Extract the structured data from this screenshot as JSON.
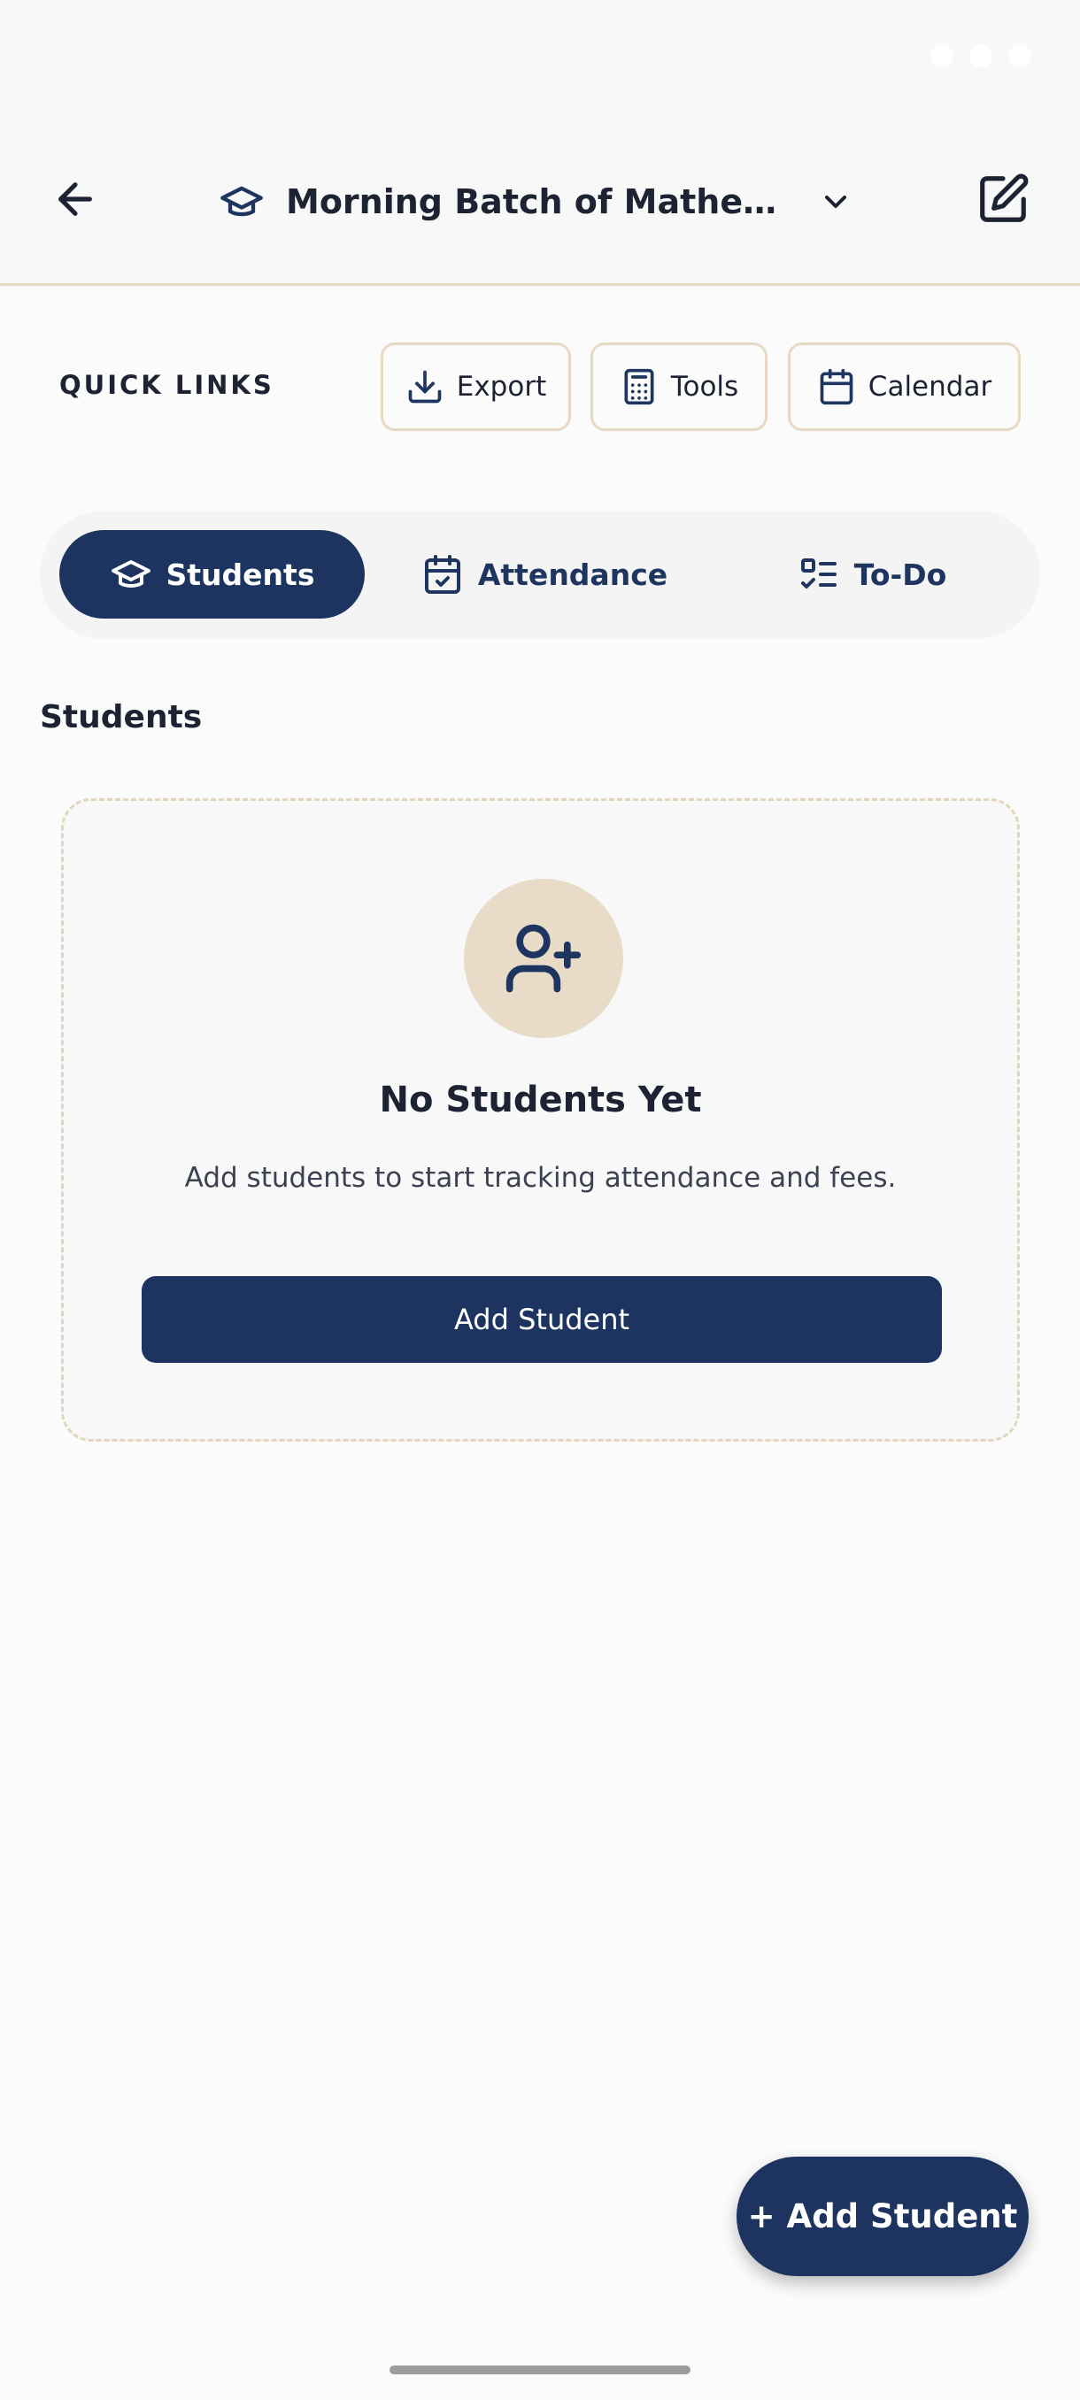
{
  "header": {
    "title": "Morning Batch of Mathemati...",
    "icon": "graduation-cap-icon"
  },
  "quick_links": {
    "label": "QUICK LINKS",
    "items": [
      {
        "label": "Export",
        "icon": "download-icon"
      },
      {
        "label": "Tools",
        "icon": "calculator-icon"
      },
      {
        "label": "Calendar",
        "icon": "calendar-icon"
      }
    ]
  },
  "tabs": [
    {
      "label": "Students",
      "icon": "graduation-cap-icon",
      "active": true
    },
    {
      "label": "Attendance",
      "icon": "calendar-check-icon",
      "active": false
    },
    {
      "label": "To-Do",
      "icon": "checklist-icon",
      "active": false
    }
  ],
  "section": {
    "title": "Students"
  },
  "empty_state": {
    "icon": "user-plus-icon",
    "title": "No Students Yet",
    "description": "Add students to start tracking attendance and fees.",
    "button_label": "Add Student"
  },
  "fab": {
    "label": "+ Add Student"
  },
  "colors": {
    "primary": "#1D3461",
    "accent_beige": "#E8DCC9",
    "border_beige": "#E8D9C6",
    "background": "#FBFBFB"
  }
}
